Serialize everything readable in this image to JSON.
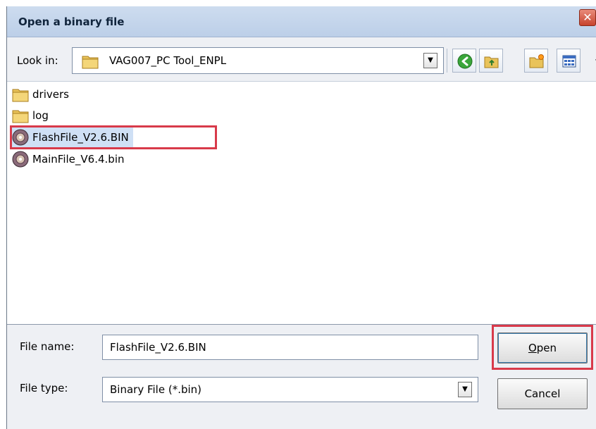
{
  "window": {
    "title": "Open a binary file",
    "close_glyph": "✕"
  },
  "lookin": {
    "label": "Look in:",
    "value": "VAG007_PC Tool_ENPL"
  },
  "toolbar": {
    "icons": [
      "back-arrow-icon",
      "up-folder-icon",
      "new-folder-icon",
      "view-menu-icon"
    ]
  },
  "files": [
    {
      "name": "drivers",
      "type": "folder",
      "selected": false,
      "highlighted": false
    },
    {
      "name": "log",
      "type": "folder",
      "selected": false,
      "highlighted": false
    },
    {
      "name": "FlashFile_V2.6.BIN",
      "type": "binary",
      "selected": true,
      "highlighted": true
    },
    {
      "name": "MainFile_V6.4.bin",
      "type": "binary",
      "selected": false,
      "highlighted": false
    }
  ],
  "filename": {
    "label": "File name:",
    "value": "FlashFile_V2.6.BIN"
  },
  "filetype": {
    "label": "File type:",
    "value": "Binary File (*.bin)"
  },
  "buttons": {
    "open_accel": "O",
    "open_rest": "pen",
    "cancel": "Cancel"
  },
  "colors": {
    "highlight": "#d83a4a",
    "selection": "#cfe0f5",
    "title_bar": "#c6d7ed"
  }
}
